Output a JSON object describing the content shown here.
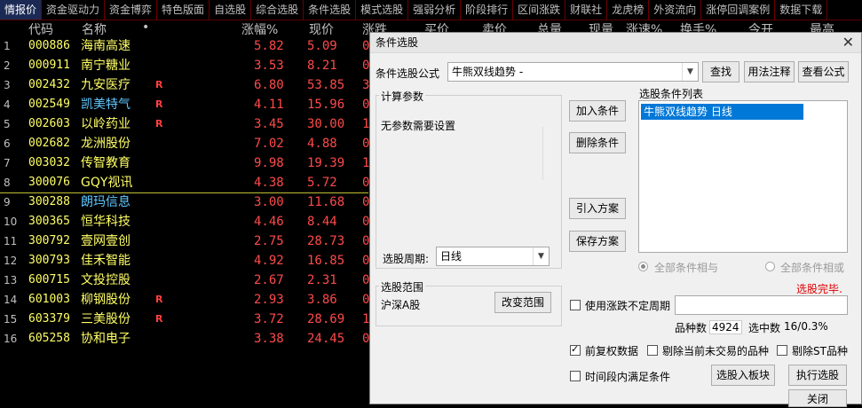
{
  "tabs": [
    "情报价",
    "资金驱动力",
    "资金博弈",
    "特色版面",
    "自选股",
    "综合选股",
    "条件选股",
    "模式选股",
    "强弱分析",
    "阶段排行",
    "区间涨跌",
    "财联社",
    "龙虎榜",
    "外资流向",
    "涨停回调案例",
    "数据下载"
  ],
  "columns": [
    "代码",
    "名称",
    "•",
    "涨幅%",
    "现价",
    "涨跌",
    "买价",
    "卖价",
    "总量",
    "现量",
    "涨速%",
    "换手%",
    "今开",
    "最高"
  ],
  "rows": [
    {
      "n": "1",
      "code": "000886",
      "name": "海南高速",
      "flag": "",
      "chg": "5.82",
      "price": "5.09",
      "cut": "0"
    },
    {
      "n": "2",
      "code": "000911",
      "name": "南宁糖业",
      "flag": "",
      "chg": "3.53",
      "price": "8.21",
      "cut": "0"
    },
    {
      "n": "3",
      "code": "002432",
      "name": "九安医疗",
      "flag": "R",
      "chg": "6.80",
      "price": "53.85",
      "cut": "3"
    },
    {
      "n": "4",
      "code": "002549",
      "name": "凯美特气",
      "flag": "R",
      "chg": "4.11",
      "price": "15.96",
      "cut": "0"
    },
    {
      "n": "5",
      "code": "002603",
      "name": "以岭药业",
      "flag": "R",
      "chg": "3.45",
      "price": "30.00",
      "cut": "1"
    },
    {
      "n": "6",
      "code": "002682",
      "name": "龙洲股份",
      "flag": "",
      "chg": "7.02",
      "price": "4.88",
      "cut": "0"
    },
    {
      "n": "7",
      "code": "003032",
      "name": "传智教育",
      "flag": "",
      "chg": "9.98",
      "price": "19.39",
      "cut": "1"
    },
    {
      "n": "8",
      "code": "300076",
      "name": "GQY视讯",
      "flag": "",
      "chg": "4.38",
      "price": "5.72",
      "cut": "0"
    },
    {
      "n": "9",
      "code": "300288",
      "name": "朗玛信息",
      "flag": "",
      "chg": "3.00",
      "price": "11.68",
      "cut": "0"
    },
    {
      "n": "10",
      "code": "300365",
      "name": "恒华科技",
      "flag": "",
      "chg": "4.46",
      "price": "8.44",
      "cut": "0"
    },
    {
      "n": "11",
      "code": "300792",
      "name": "壹网壹创",
      "flag": "",
      "chg": "2.75",
      "price": "28.73",
      "cut": "0"
    },
    {
      "n": "12",
      "code": "300793",
      "name": "佳禾智能",
      "flag": "",
      "chg": "4.92",
      "price": "16.85",
      "cut": "0"
    },
    {
      "n": "13",
      "code": "600715",
      "name": "文投控股",
      "flag": "",
      "chg": "2.67",
      "price": "2.31",
      "cut": "0"
    },
    {
      "n": "14",
      "code": "601003",
      "name": "柳钢股份",
      "flag": "R",
      "chg": "2.93",
      "price": "3.86",
      "cut": "0"
    },
    {
      "n": "15",
      "code": "603379",
      "name": "三美股份",
      "flag": "R",
      "chg": "3.72",
      "price": "28.69",
      "cut": "1"
    },
    {
      "n": "16",
      "code": "605258",
      "name": "协和电子",
      "flag": "",
      "chg": "3.38",
      "price": "24.45",
      "cut": "0"
    }
  ],
  "dialog": {
    "title": "条件选股",
    "formula_label": "条件选股公式",
    "formula_value": "牛熊双线趋势 -",
    "find": "查找",
    "usage": "用法注释",
    "view_formula": "查看公式",
    "params_group": "计算参数",
    "no_params": "无参数需要设置",
    "add_cond": "加入条件",
    "del_cond": "删除条件",
    "import_plan": "引入方案",
    "save_plan": "保存方案",
    "cond_list_label": "选股条件列表",
    "cond_item": "牛熊双线趋势  日线",
    "all_and": "全部条件相与",
    "all_or": "全部条件相或",
    "done": "选股完毕.",
    "period_label": "选股周期:",
    "period_value": "日线",
    "range_group": "选股范围",
    "range_value": "沪深A股",
    "change_range": "改变范围",
    "uncertain_period": "使用涨跌不定周期",
    "count_label": "品种数",
    "count_value": "4924",
    "hit_label": "选中数",
    "hit_value": "16/0.3%",
    "pre_adj": "前复权数据",
    "exclude_no_trade": "剔除当前未交易的品种",
    "exclude_st": "剔除ST品种",
    "select_into_block": "选股入板块",
    "run": "执行选股",
    "in_period": "时间段内满足条件",
    "close": "关闭"
  },
  "colors": {
    "up": "#ff4a4a",
    "code": "#ffff66",
    "selected": "#0078d7"
  }
}
